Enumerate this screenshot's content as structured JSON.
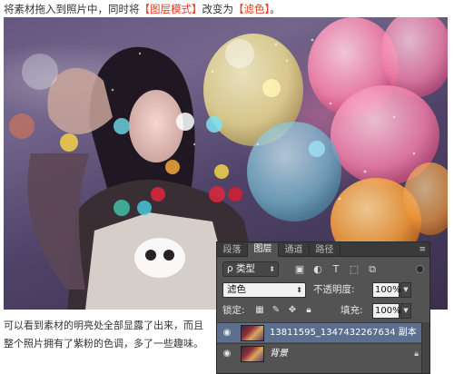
{
  "caption": {
    "prefix": "将素材拖入到照片中，同时将",
    "highlight1": "【图层模式】",
    "middle": "改变为",
    "highlight2": "【滤色】",
    "suffix": "。"
  },
  "body_text": "可以看到素材的明亮处全部显露了出来，而且整个照片拥有了紫粉的色调，多了一些趣味。",
  "colors": {
    "highlight": "#e23b1e",
    "panel_bg": "#535353",
    "selected_row": "#5c6f8f"
  },
  "layers_panel": {
    "tabs": [
      "段落",
      "图层",
      "通道",
      "路径"
    ],
    "active_tab": "图层",
    "menu_icon": "≡",
    "kind_label": "ρ 类型",
    "filter_icons": [
      "image-filter-icon",
      "adjustment-filter-icon",
      "type-filter-icon",
      "shape-filter-icon",
      "smart-object-filter-icon"
    ],
    "blend_mode": "滤色",
    "opacity_label": "不透明度:",
    "opacity_value": "100%",
    "lock_label": "锁定:",
    "fill_label": "填充:",
    "fill_value": "100%",
    "layers": [
      {
        "name": "13811595_1347432267634 副本",
        "selected": true,
        "locked": false
      },
      {
        "name": "背景",
        "selected": false,
        "locked": true
      }
    ]
  }
}
